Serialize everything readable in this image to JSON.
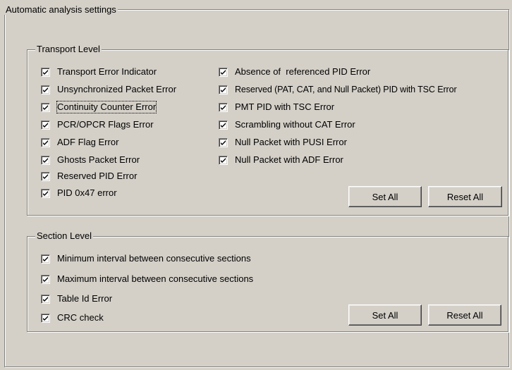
{
  "dialog": {
    "outer_title": "Automatic analysis settings"
  },
  "transport": {
    "title": "Transport Level",
    "left_items": [
      {
        "label": "Transport Error Indicator",
        "checked": true
      },
      {
        "label": "Unsynchronized Packet Error",
        "checked": true
      },
      {
        "label": "Continuity Counter Error",
        "checked": true
      },
      {
        "label": "PCR/OPCR Flags Error",
        "checked": true
      },
      {
        "label": "ADF Flag Error",
        "checked": true
      },
      {
        "label": "Ghosts Packet Error",
        "checked": true
      },
      {
        "label": "Reserved PID Error",
        "checked": true
      },
      {
        "label": "PID 0x47 error",
        "checked": true
      }
    ],
    "right_items": [
      {
        "label": "Absence of  referenced PID Error",
        "checked": true
      },
      {
        "label": "Reserved (PAT, CAT, and Null Packet) PID with TSC Error",
        "checked": true
      },
      {
        "label": "PMT PID with TSC Error",
        "checked": true
      },
      {
        "label": "Scrambling without CAT Error",
        "checked": true
      },
      {
        "label": "Null Packet with PUSI Error",
        "checked": true
      },
      {
        "label": "Null Packet with ADF Error",
        "checked": true
      }
    ],
    "set_all_label": "Set All",
    "reset_all_label": "Reset All"
  },
  "section": {
    "title": "Section Level",
    "items": [
      {
        "label": "Minimum interval between consecutive sections",
        "checked": true
      },
      {
        "label": "Maximum interval between consecutive sections",
        "checked": true
      },
      {
        "label": "Table Id Error",
        "checked": true
      },
      {
        "label": "CRC check",
        "checked": true
      }
    ],
    "set_all_label": "Set All",
    "reset_all_label": "Reset All"
  },
  "colors": {
    "face": "#d4d0c8",
    "shadow": "#808080",
    "highlight": "#ffffff"
  }
}
